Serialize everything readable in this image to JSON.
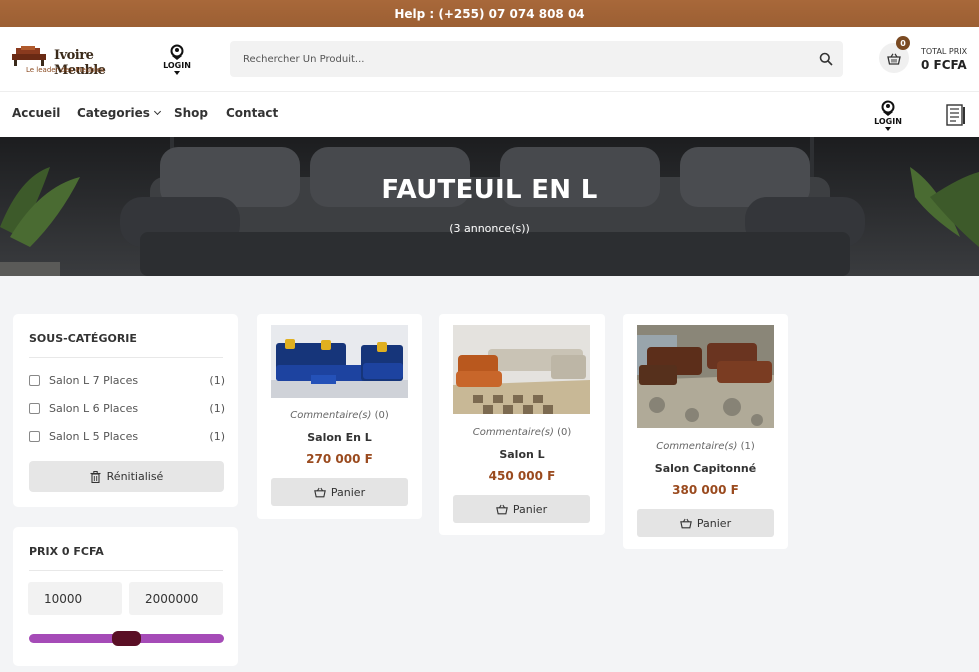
{
  "topbar": {
    "help_text": "Help : (+255) 07 074 808 04"
  },
  "header": {
    "logo_text": "Ivoire Meuble",
    "logo_tagline": "Le leader des Meubles",
    "login_label": "LOGIN",
    "search_placeholder": "Rechercher Un Produit...",
    "cart_count": "0",
    "total_label": "TOTAL PRIX",
    "total_value": "0 FCFA"
  },
  "nav": {
    "items": [
      "Accueil",
      "Categories",
      "Shop",
      "Contact"
    ],
    "login_label": "LOGIN"
  },
  "hero": {
    "title": "FAUTEUIL EN L",
    "count": "(3 annonce(s))"
  },
  "sidebar": {
    "subcategory_title": "SOUS-CATÉGORIE",
    "subcategories": [
      {
        "label": "Salon L 7 Places",
        "count": "(1)"
      },
      {
        "label": "Salon L 6 Places",
        "count": "(1)"
      },
      {
        "label": "Salon L 5 Places",
        "count": "(1)"
      }
    ],
    "reset_label": "Rénitialisé",
    "price_title": "PRIX 0 FCFA",
    "price_min": "10000",
    "price_max": "2000000",
    "slider_fraction": 0.5
  },
  "products": [
    {
      "comment_label": "Commentaire(s)",
      "comment_count": "(0)",
      "name": "Salon En L",
      "price": "270 000 F",
      "button": "Panier"
    },
    {
      "comment_label": "Commentaire(s)",
      "comment_count": "(0)",
      "name": "Salon L",
      "price": "450 000 F",
      "button": "Panier"
    },
    {
      "comment_label": "Commentaire(s)",
      "comment_count": "(1)",
      "name": "Salon Capitonné",
      "price": "380 000 F",
      "button": "Panier"
    }
  ],
  "colors": {
    "topbar": "#a8683a",
    "accent_brown": "#7a4a22",
    "price_color": "#9a4a1e",
    "slider_track": "#a54bb7",
    "slider_thumb": "#5a0f25"
  }
}
